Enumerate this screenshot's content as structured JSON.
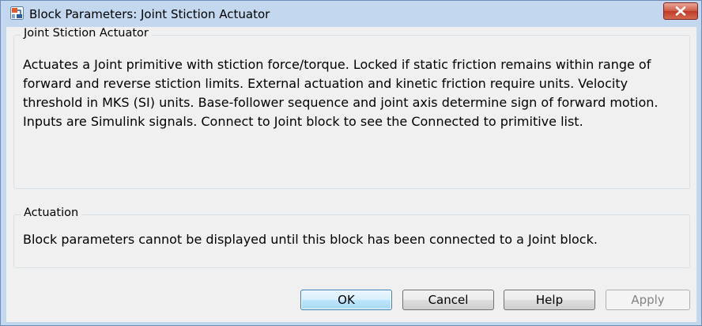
{
  "window": {
    "title": "Block Parameters: Joint Stiction Actuator",
    "icon": "simulink-block-icon",
    "close_icon": "close-icon"
  },
  "description_group": {
    "label": "Joint Stiction Actuator",
    "text": "Actuates a Joint primitive with stiction force/torque. Locked if static friction remains within range of forward and reverse stiction limits. External actuation and kinetic friction require units. Velocity threshold in MKS (SI) units. Base-follower sequence and joint axis determine sign of forward motion. Inputs are Simulink signals. Connect to Joint block to see the Connected to primitive list."
  },
  "actuation_group": {
    "label": "Actuation",
    "message": "Block parameters cannot be displayed until this block has been connected to a Joint block."
  },
  "buttons": {
    "ok": "OK",
    "cancel": "Cancel",
    "help": "Help",
    "apply": "Apply"
  }
}
